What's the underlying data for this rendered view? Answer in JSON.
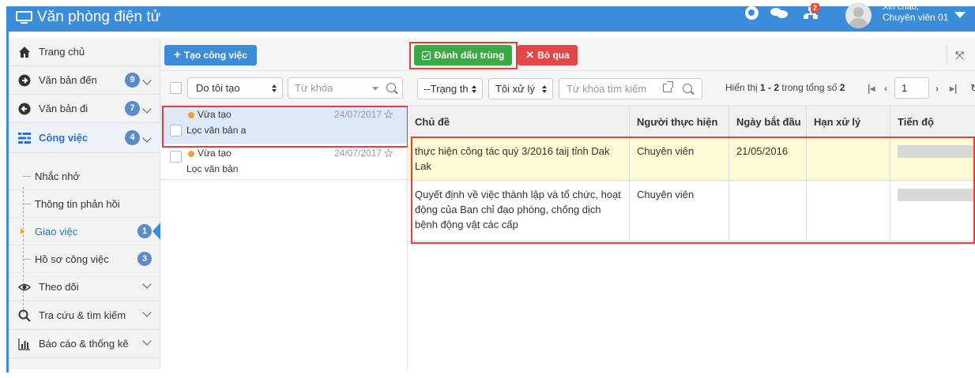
{
  "header": {
    "app_title": "Văn phòng điện tử",
    "notification_count": "2",
    "greeting": "Xin chào,",
    "user_name": "Chuyên viên 01",
    "brand_color": "#3c8dd9"
  },
  "sidebar": {
    "items": [
      {
        "label": "Trang chủ",
        "icon": "home-icon"
      },
      {
        "label": "Văn bản đến",
        "count": "9",
        "icon": "arrow-circle-right-icon"
      },
      {
        "label": "Văn bản đi",
        "count": "7",
        "icon": "arrow-circle-left-icon"
      },
      {
        "label": "Công việc",
        "count": "4",
        "icon": "tasks-icon"
      },
      {
        "label": "Theo dõi",
        "icon": "eye-icon"
      },
      {
        "label": "Tra cứu & tìm kiếm",
        "icon": "search-icon"
      },
      {
        "label": "Báo cáo & thống kê",
        "icon": "bar-chart-icon"
      }
    ],
    "sub_items": [
      {
        "label": "Nhắc nhở"
      },
      {
        "label": "Thông tin phản hồi"
      },
      {
        "label": "Giao việc",
        "count": "1"
      },
      {
        "label": "Hồ sơ công việc",
        "count": "3"
      }
    ]
  },
  "tasks": {
    "create_button": "Tạo công việc",
    "filter_select": "Do tôi tạo",
    "keyword_placeholder": "Từ khóa",
    "items": [
      {
        "status": "Vừa tạo",
        "date": "24/07/2017",
        "title": "Lọc văn bản a"
      },
      {
        "status": "Vừa tạo",
        "date": "24/07/2017",
        "title": "Lọc văn bản"
      }
    ]
  },
  "toolbar": {
    "mark_duplicate": "Đánh dấu trùng",
    "skip": "Bỏ qua"
  },
  "filters": {
    "status_select": "--Trạng th",
    "handler_select": "Tôi xử lý",
    "keyword_placeholder": "Từ khóa tìm kiếm"
  },
  "paging": {
    "prefix": "Hiển thị",
    "range": "1 - 2",
    "middle": "trong tổng số",
    "total": "2",
    "page": "1"
  },
  "table": {
    "headers": [
      "Chủ đề",
      "Người thực hiện",
      "Ngày bắt đầu",
      "Hạn xử lý",
      "Tiến độ"
    ],
    "rows": [
      {
        "subject": "thực hiện công tác quý 3/2016 taij tỉnh Dak Lak",
        "assignee": "Chuyên viên",
        "start_date": "21/05/2016",
        "deadline": ""
      },
      {
        "subject": "Quyết định về việc thành lập và tổ chức, hoạt động của Ban chỉ đạo phòng, chống dịch bệnh động vật các cấp",
        "assignee": "Chuyên viên",
        "start_date": "",
        "deadline": ""
      }
    ]
  }
}
